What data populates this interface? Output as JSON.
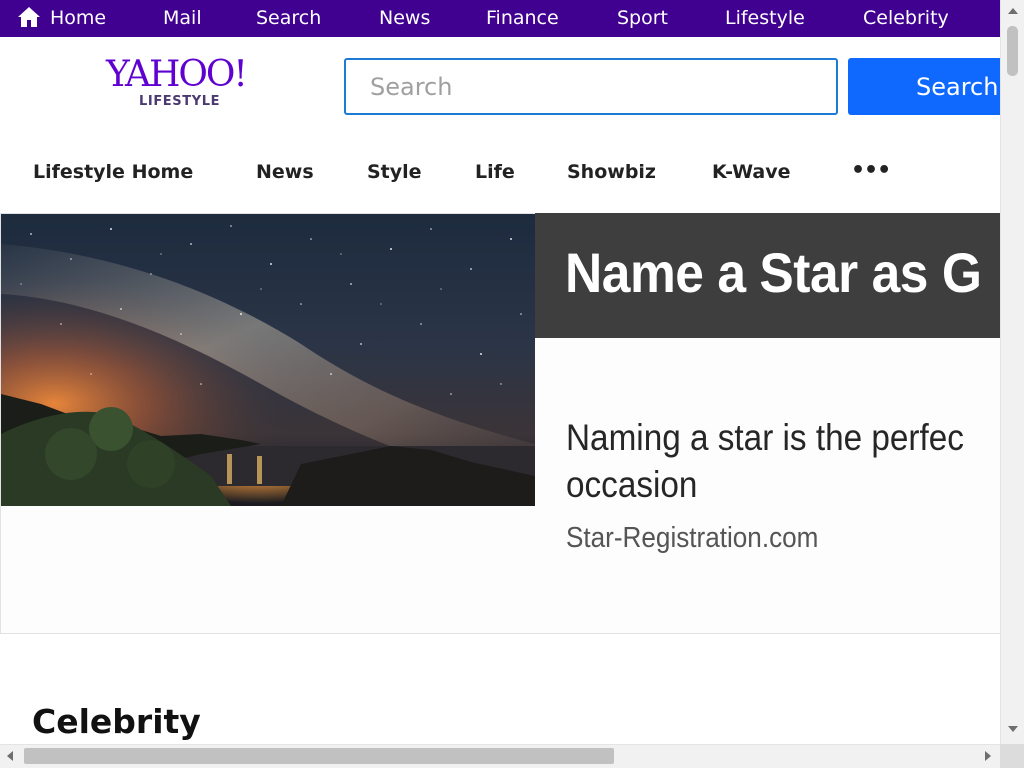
{
  "topnav": {
    "items": [
      {
        "label": "Home",
        "icon": "home-icon"
      },
      {
        "label": "Mail"
      },
      {
        "label": "Search"
      },
      {
        "label": "News"
      },
      {
        "label": "Finance"
      },
      {
        "label": "Sport"
      },
      {
        "label": "Lifestyle"
      },
      {
        "label": "Celebrity"
      }
    ],
    "background": "#400090"
  },
  "header": {
    "logo_text": "YAHOO!",
    "logo_subtext": "LIFESTYLE",
    "search_placeholder": "Search",
    "search_button_label": "Search",
    "brand_color": "#5f01d1",
    "button_color": "#0f69ff"
  },
  "section_nav": {
    "items": [
      "Lifestyle Home",
      "News",
      "Style",
      "Life",
      "Showbiz",
      "K-Wave"
    ],
    "more_label": "•••"
  },
  "ad": {
    "headline": "Name a Star as G",
    "description": "Naming a star is the perfec occasion",
    "source": "Star-Registration.com",
    "image": "milky-way-night-sky-over-coast"
  },
  "main": {
    "section_title": "Celebrity"
  }
}
